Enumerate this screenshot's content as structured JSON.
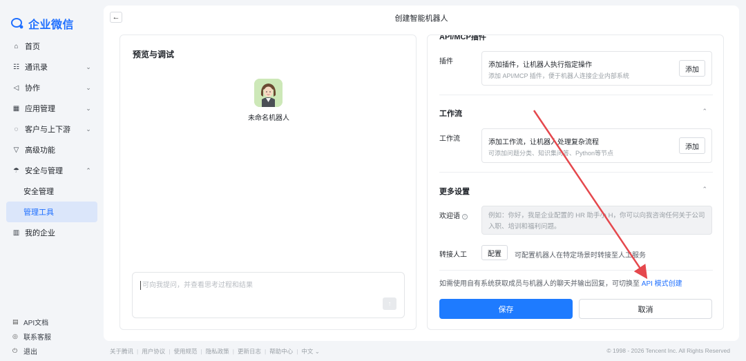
{
  "brand": {
    "name": "企业微信"
  },
  "sidebar": {
    "items": [
      {
        "label": "首页",
        "icon": "home-icon",
        "glyph": "⌂",
        "chevron": ""
      },
      {
        "label": "通讯录",
        "icon": "org-chart-icon",
        "glyph": "☷",
        "chevron": "⌄"
      },
      {
        "label": "协作",
        "icon": "collaboration-icon",
        "glyph": "◁",
        "chevron": "⌄"
      },
      {
        "label": "应用管理",
        "icon": "apps-grid-icon",
        "glyph": "▦",
        "chevron": "⌄"
      },
      {
        "label": "客户与上下游",
        "icon": "chat-bubble-icon",
        "glyph": "◌",
        "chevron": "⌄"
      },
      {
        "label": "高级功能",
        "icon": "advanced-icon",
        "glyph": "▽",
        "chevron": ""
      },
      {
        "label": "安全与管理",
        "icon": "umbrella-icon",
        "glyph": "☂",
        "chevron": "⌃"
      },
      {
        "label": "安全管理",
        "sub": true
      },
      {
        "label": "管理工具",
        "sub": true,
        "active": true
      },
      {
        "label": "我的企业",
        "icon": "building-icon",
        "glyph": "▥",
        "chevron": ""
      }
    ],
    "bottom": [
      {
        "label": "API文档",
        "icon": "doc-icon",
        "glyph": "▤"
      },
      {
        "label": "联系客服",
        "icon": "headset-icon",
        "glyph": "◎"
      },
      {
        "label": "退出",
        "icon": "power-icon",
        "glyph": "⏻"
      }
    ]
  },
  "header": {
    "title": "创建智能机器人"
  },
  "preview": {
    "title": "预览与调试",
    "bot_name": "未命名机器人",
    "chat_placeholder": "可向我提问，并查看思考过程和结果"
  },
  "settings": {
    "plugin_section_title": "API/MCP插件",
    "plugin_label": "插件",
    "plugin_card_title": "添加插件，让机器人执行指定操作",
    "plugin_card_desc": "添加 API/MCP 插件，便于机器人连接企业内部系统",
    "add_label": "添加",
    "workflow_section_title": "工作流",
    "workflow_label": "工作流",
    "workflow_card_title": "添加工作流，让机器人处理复杂流程",
    "workflow_card_desc": "可添加问题分类、知识集问答、Python等节点",
    "more_section_title": "更多设置",
    "welcome_label": "欢迎语",
    "welcome_placeholder": "例如：你好，我是企业配置的 HR 助手小 H，你可以向我咨询任何关于公司入职、培训和福利问题。",
    "handoff_label": "转接人工",
    "config_label": "配置",
    "handoff_desc": "可配置机器人在特定场景时转接至人工服务",
    "api_note": "如需使用自有系统获取成员与机器人的聊天并输出回复，可切换至",
    "api_link": "API 模式创建",
    "save_label": "保存",
    "cancel_label": "取消"
  },
  "footer": {
    "links": [
      "关于腾讯",
      "用户协议",
      "使用规范",
      "隐私政策",
      "更新日志",
      "帮助中心",
      "中文 ⌄"
    ],
    "copyright": "© 1998 - 2026 Tencent Inc. All Rights Reserved"
  },
  "colors": {
    "accent": "#1e7bff",
    "annotation_arrow": "#e5484d",
    "active_bg": "#dbe6fa"
  }
}
